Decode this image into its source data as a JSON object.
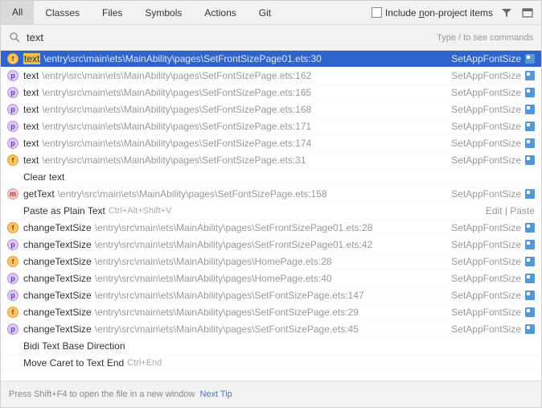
{
  "tabs": {
    "items": [
      "All",
      "Classes",
      "Files",
      "Symbols",
      "Actions",
      "Git"
    ],
    "active": 0,
    "includeNonProject": {
      "prefix": "Include ",
      "underlined": "n",
      "suffix": "on-project items"
    }
  },
  "search": {
    "value": "text",
    "hint": "Type / to see commands"
  },
  "results": [
    {
      "kind": "f",
      "selected": true,
      "label": "text",
      "highlight": true,
      "path": "\\entry\\src\\main\\ets\\MainAbility\\pages\\SetFrontSizePage01.ets:30",
      "right": "SetAppFontSize",
      "rightIcon": true
    },
    {
      "kind": "p",
      "label": "text",
      "path": "\\entry\\src\\main\\ets\\MainAbility\\pages\\SetFontSizePage.ets:162",
      "right": "SetAppFontSize",
      "rightIcon": true
    },
    {
      "kind": "p",
      "label": "text",
      "path": "\\entry\\src\\main\\ets\\MainAbility\\pages\\SetFontSizePage.ets:165",
      "right": "SetAppFontSize",
      "rightIcon": true
    },
    {
      "kind": "p",
      "label": "text",
      "path": "\\entry\\src\\main\\ets\\MainAbility\\pages\\SetFontSizePage.ets:168",
      "right": "SetAppFontSize",
      "rightIcon": true
    },
    {
      "kind": "p",
      "label": "text",
      "path": "\\entry\\src\\main\\ets\\MainAbility\\pages\\SetFontSizePage.ets:171",
      "right": "SetAppFontSize",
      "rightIcon": true
    },
    {
      "kind": "p",
      "label": "text",
      "path": "\\entry\\src\\main\\ets\\MainAbility\\pages\\SetFontSizePage.ets:174",
      "right": "SetAppFontSize",
      "rightIcon": true
    },
    {
      "kind": "f",
      "label": "text",
      "path": "\\entry\\src\\main\\ets\\MainAbility\\pages\\SetFontSizePage.ets:31",
      "right": "SetAppFontSize",
      "rightIcon": true
    },
    {
      "kind": "action",
      "label": "Clear text"
    },
    {
      "kind": "m",
      "label": "getText",
      "path": "\\entry\\src\\main\\ets\\MainAbility\\pages\\SetFontSizePage.ets:158",
      "right": "SetAppFontSize",
      "rightIcon": true
    },
    {
      "kind": "action",
      "label": "Paste as Plain Text",
      "shortcut": "Ctrl+Alt+Shift+V",
      "right": "Edit | Paste"
    },
    {
      "kind": "f",
      "label": "changeTextSize",
      "path": "\\entry\\src\\main\\ets\\MainAbility\\pages\\SetFrontSizePage01.ets:28",
      "right": "SetAppFontSize",
      "rightIcon": true
    },
    {
      "kind": "p",
      "label": "changeTextSize",
      "path": "\\entry\\src\\main\\ets\\MainAbility\\pages\\SetFrontSizePage01.ets:42",
      "right": "SetAppFontSize",
      "rightIcon": true
    },
    {
      "kind": "f",
      "label": "changeTextSize",
      "path": "\\entry\\src\\main\\ets\\MainAbility\\pages\\HomePage.ets:28",
      "right": "SetAppFontSize",
      "rightIcon": true
    },
    {
      "kind": "p",
      "label": "changeTextSize",
      "path": "\\entry\\src\\main\\ets\\MainAbility\\pages\\HomePage.ets:40",
      "right": "SetAppFontSize",
      "rightIcon": true
    },
    {
      "kind": "p",
      "label": "changeTextSize",
      "path": "\\entry\\src\\main\\ets\\MainAbility\\pages\\SetFontSizePage.ets:147",
      "right": "SetAppFontSize",
      "rightIcon": true
    },
    {
      "kind": "f",
      "label": "changeTextSize",
      "path": "\\entry\\src\\main\\ets\\MainAbility\\pages\\SetFontSizePage.ets:29",
      "right": "SetAppFontSize",
      "rightIcon": true
    },
    {
      "kind": "p",
      "label": "changeTextSize",
      "path": "\\entry\\src\\main\\ets\\MainAbility\\pages\\SetFontSizePage.ets:45",
      "right": "SetAppFontSize",
      "rightIcon": true
    },
    {
      "kind": "action",
      "label": "Bidi Text Base Direction"
    },
    {
      "kind": "action",
      "label": "Move Caret to Text End",
      "shortcut": "Ctrl+End"
    }
  ],
  "footer": {
    "hint": "Press Shift+F4 to open the file in a new window",
    "link": "Next Tip"
  }
}
